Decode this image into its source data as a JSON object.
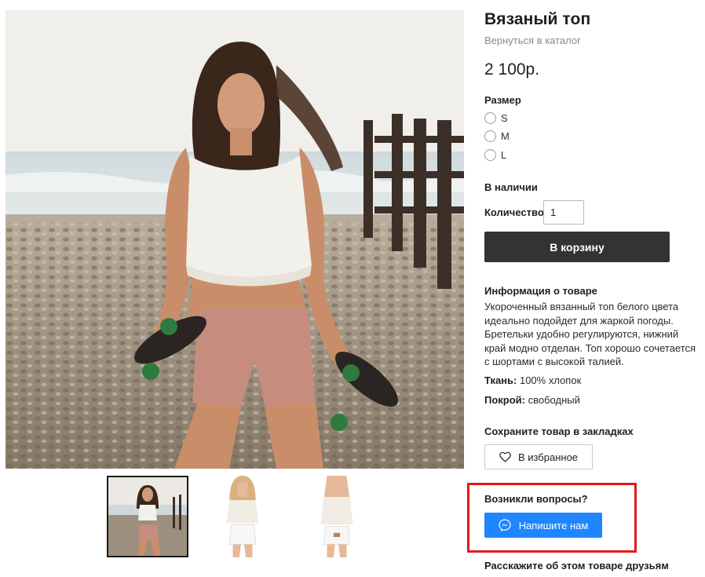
{
  "product": {
    "title": "Вязаный топ",
    "back_link": "Вернуться в каталог",
    "price": "2 100р."
  },
  "size": {
    "label": "Размер",
    "options": [
      "S",
      "M",
      "L"
    ]
  },
  "stock": "В наличии",
  "quantity": {
    "label": "Количество:",
    "value": "1"
  },
  "cart_button": "В корзину",
  "info": {
    "title": "Информация о товаре",
    "description": "Укороченный вязанный топ белого цвета идеально подойдет для жаркой погоды. Бретельки удобно регулируются, нижний край модно отделан. Топ хорошо сочетается с шортами с высокой талией.",
    "fabric_label": "Ткань:",
    "fabric_value": " 100% хлопок",
    "cut_label": "Покрой:",
    "cut_value": " свободный"
  },
  "bookmarks": {
    "title": "Сохраните товар в закладках",
    "button": "В избранное"
  },
  "questions": {
    "title": "Возникли вопросы?",
    "button": "Напишите нам",
    "highlight_color": "#e11b1b",
    "button_color": "#1f86ff"
  },
  "share_title": "Расскажите об этом товаре друзьям",
  "icons": {
    "heart": "heart-icon",
    "messenger": "messenger-icon"
  }
}
